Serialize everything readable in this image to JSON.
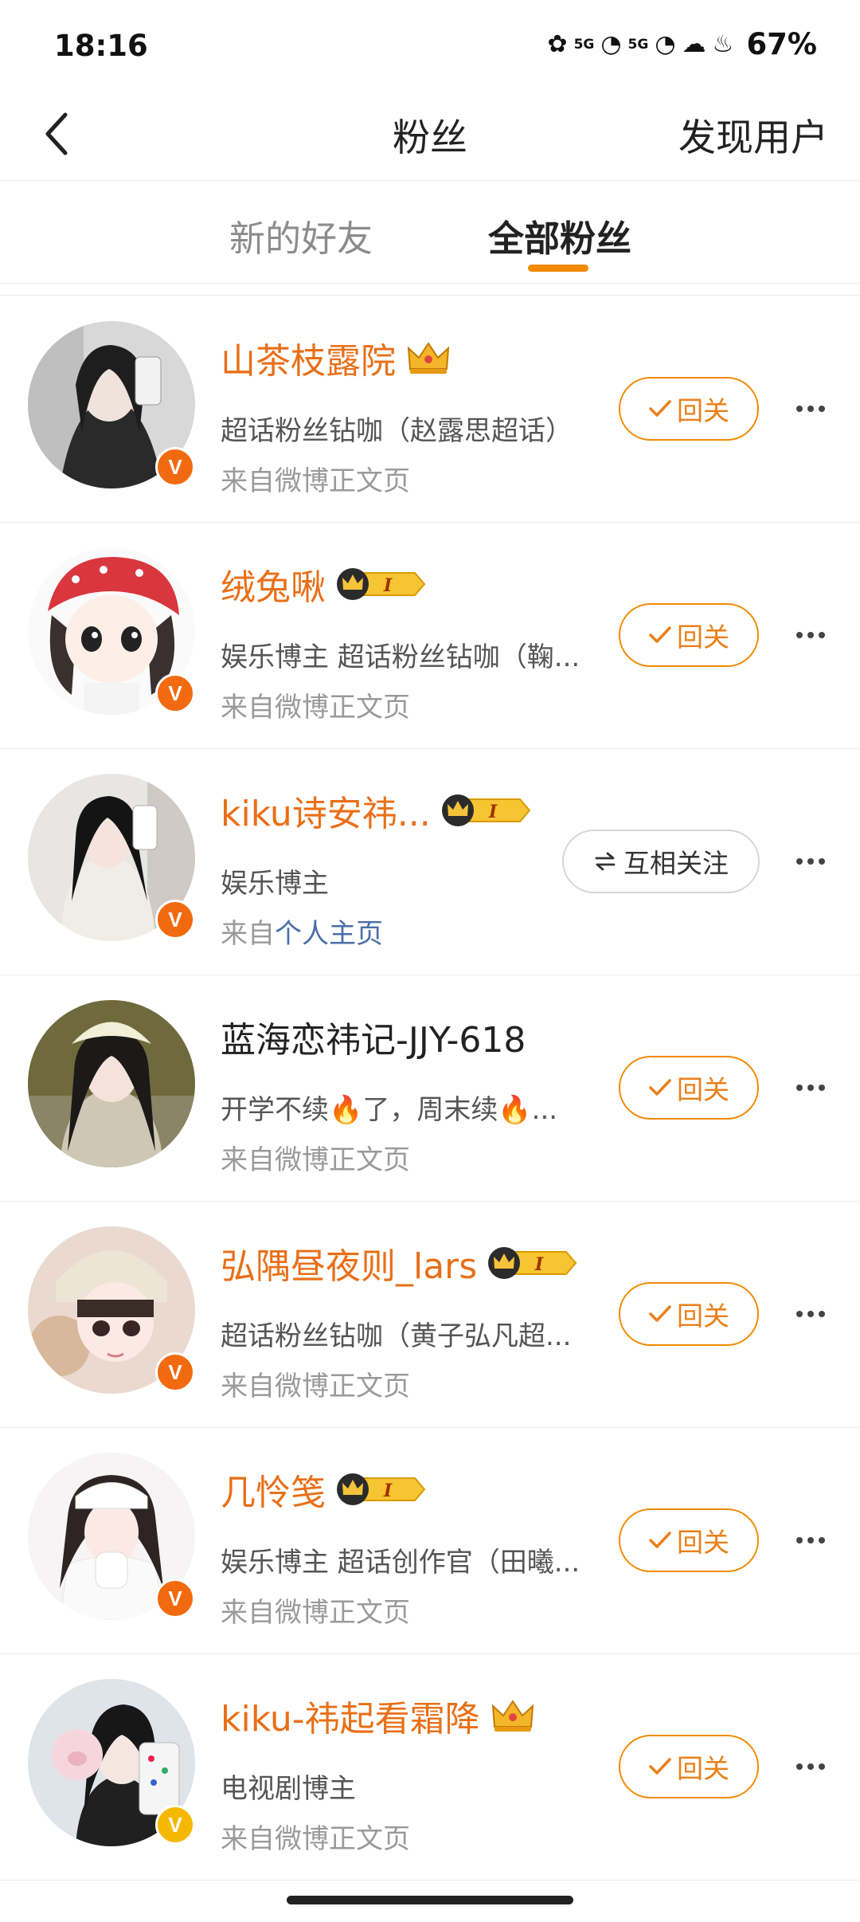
{
  "status_bar": {
    "time": "18:16",
    "battery": "67%",
    "net1": "5G",
    "net2": "5G"
  },
  "nav": {
    "back_icon": "chevron-left-icon",
    "title": "粉丝",
    "discover": "发现用户"
  },
  "tabs": [
    {
      "label": "新的好友",
      "active": false
    },
    {
      "label": "全部粉丝",
      "active": true
    }
  ],
  "colors": {
    "accent": "#f08a00",
    "name_orange": "#e96f17",
    "verify_orange": "#f26a0f",
    "verify_gold": "#f5b800"
  },
  "follow_back_label": "回关",
  "mutual_label": "互相关注",
  "fans": [
    {
      "name": "山茶枝露院",
      "badge": "crown",
      "desc": "超话粉丝钻咖（赵露思超话）",
      "source_prefix": "来自",
      "source": "微博正文页",
      "action": "follow"
    },
    {
      "name": "绒兔啾",
      "badge": "level",
      "level": "I",
      "desc": "娱乐博主 超话粉丝钻咖（鞠...",
      "source_prefix": "来自",
      "source": "微博正文页",
      "action": "follow"
    },
    {
      "name": "kiku诗安祎...",
      "badge": "level",
      "level": "I",
      "desc": "娱乐博主",
      "source_prefix": "来自",
      "source": "个人主页",
      "action": "mutual"
    },
    {
      "name": "蓝海恋祎记-JJY-618",
      "badge": "none",
      "desc": "开学不续🔥了，周末续🔥...",
      "source_prefix": "来自",
      "source": "微博正文页",
      "action": "follow"
    },
    {
      "name": "弘隅昼夜则_lars",
      "badge": "level",
      "level": "I",
      "desc": "超话粉丝钻咖（黄子弘凡超...",
      "source_prefix": "来自",
      "source": "微博正文页",
      "action": "follow"
    },
    {
      "name": "几怜笺",
      "badge": "level",
      "level": "I",
      "desc": "娱乐博主 超话创作官（田曦...",
      "source_prefix": "来自",
      "source": "微博正文页",
      "action": "follow"
    },
    {
      "name": "kiku-祎起看霜降",
      "badge": "crown",
      "desc": "电视剧博主",
      "source_prefix": "来自",
      "source": "微博正文页",
      "action": "follow"
    }
  ]
}
